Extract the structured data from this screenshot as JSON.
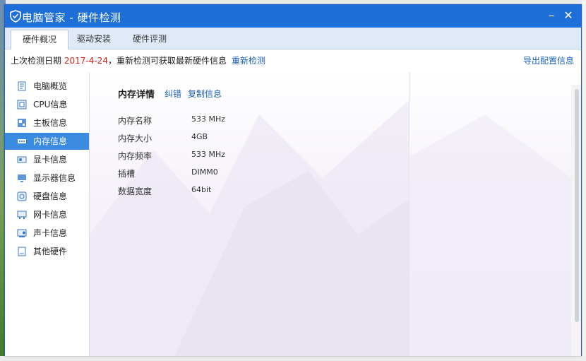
{
  "window": {
    "title": "电脑管家 - 硬件检测",
    "minimize": "–",
    "close": "✕"
  },
  "tabs": [
    {
      "label": "硬件概况"
    },
    {
      "label": "驱动安装"
    },
    {
      "label": "硬件评测"
    }
  ],
  "infobar": {
    "prefix": "上次检测日期",
    "date": "2017-4-24",
    "suffix": "，重新检测可获取最新硬件信息",
    "recheck": "重新检测",
    "export": "导出配置信息"
  },
  "sidebar": {
    "items": [
      {
        "label": "电脑概览",
        "icon": "overview-icon"
      },
      {
        "label": "CPU信息",
        "icon": "cpu-icon"
      },
      {
        "label": "主板信息",
        "icon": "motherboard-icon"
      },
      {
        "label": "内存信息",
        "icon": "memory-icon"
      },
      {
        "label": "显卡信息",
        "icon": "gpu-icon"
      },
      {
        "label": "显示器信息",
        "icon": "monitor-icon"
      },
      {
        "label": "硬盘信息",
        "icon": "disk-icon"
      },
      {
        "label": "网卡信息",
        "icon": "network-card-icon"
      },
      {
        "label": "声卡信息",
        "icon": "sound-card-icon"
      },
      {
        "label": "其他硬件",
        "icon": "other-hardware-icon"
      }
    ]
  },
  "detail": {
    "title": "内存详情",
    "correct": "纠错",
    "copy": "复制信息",
    "rows": [
      {
        "key": "内存名称",
        "value": "533 MHz"
      },
      {
        "key": "内存大小",
        "value": "4GB"
      },
      {
        "key": "内存频率",
        "value": "533 MHz"
      },
      {
        "key": "插槽",
        "value": "DIMM0"
      },
      {
        "key": "数据宽度",
        "value": "64bit"
      }
    ]
  },
  "colors": {
    "titlebar": "#1f6fd8",
    "active_item": "#3b8be0",
    "link": "#1a5fb4",
    "date": "#d9211b"
  }
}
